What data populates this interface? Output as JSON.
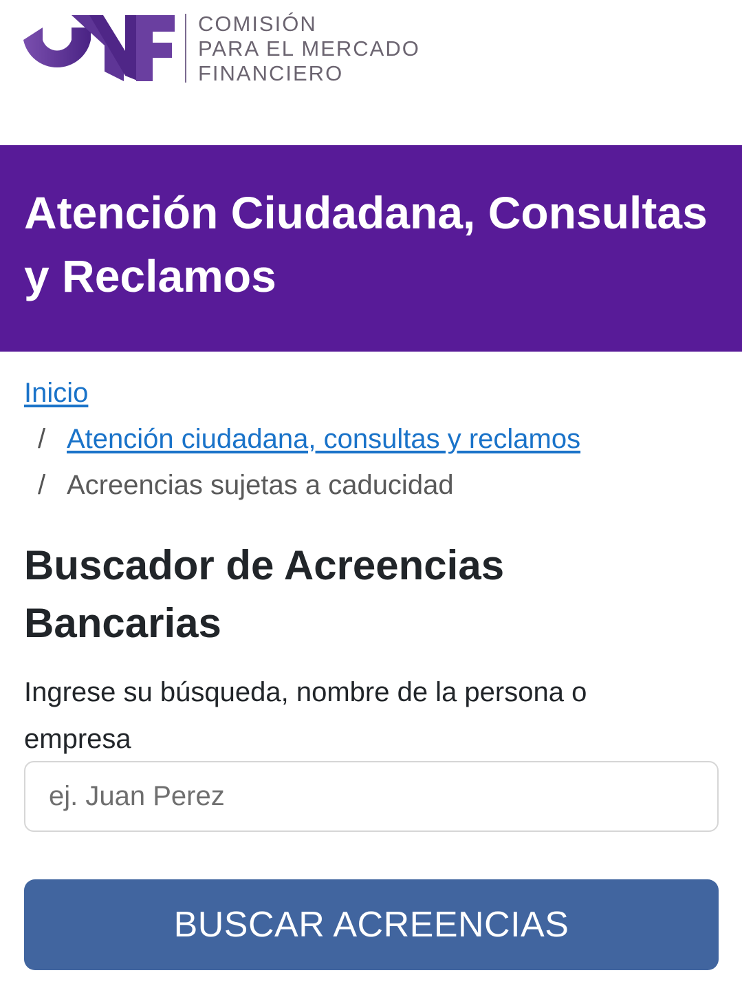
{
  "header": {
    "logo_text_lines": [
      "COMISIÓN",
      "PARA EL MERCADO",
      "FINANCIERO"
    ],
    "logo_mark": "CMF",
    "brand_colors": {
      "logo": "#5a2f8f",
      "banner": "#581b98"
    }
  },
  "banner": {
    "title": "Atención Ciudadana, Consultas y Reclamos"
  },
  "breadcrumb": {
    "home": "Inicio",
    "section": "Atención ciudadana, consultas y reclamos",
    "current": "Acreencias sujetas a caducidad",
    "separator": "/"
  },
  "main": {
    "title": "Buscador de Acreencias Bancarias",
    "search_label": "Ingrese su búsqueda, nombre de la persona o empresa",
    "search_placeholder": "ej. Juan Perez",
    "search_value": "",
    "button_label": "BUSCAR ACREENCIAS",
    "button_color": "#41659f"
  }
}
